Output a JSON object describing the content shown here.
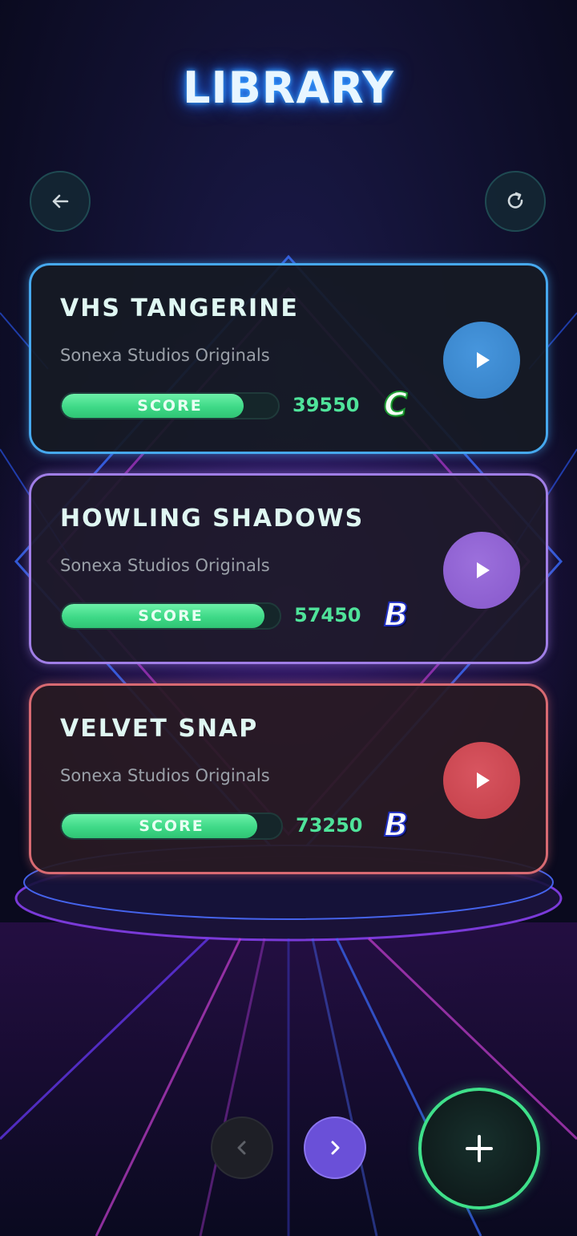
{
  "screen": {
    "title": "LIBRARY",
    "back_icon": "arrow-left-icon",
    "refresh_icon": "refresh-icon"
  },
  "songs": [
    {
      "title": "VHS TANGERINE",
      "artist": "Sonexa Studios Originals",
      "score_label": "SCORE",
      "score": "39550",
      "progress": 0.84,
      "grade": "C",
      "accent": "#46a8ee",
      "play_color": "#3a86cc"
    },
    {
      "title": "HOWLING SHADOWS",
      "artist": "Sonexa Studios Originals",
      "score_label": "SCORE",
      "score": "57450",
      "progress": 0.93,
      "grade": "B",
      "accent": "#a07ee6",
      "play_color": "#8d5fd0"
    },
    {
      "title": "VELVET SNAP",
      "artist": "Sonexa Studios Originals",
      "score_label": "SCORE",
      "score": "73250",
      "progress": 0.89,
      "grade": "B",
      "accent": "#d86a72",
      "play_color": "#c9454f"
    }
  ],
  "pagination": {
    "prev_icon": "chevron-left-icon",
    "next_icon": "chevron-right-icon",
    "prev_enabled": false,
    "next_enabled": true
  },
  "add_button": {
    "icon": "plus-icon",
    "color": "#3fe08a"
  }
}
